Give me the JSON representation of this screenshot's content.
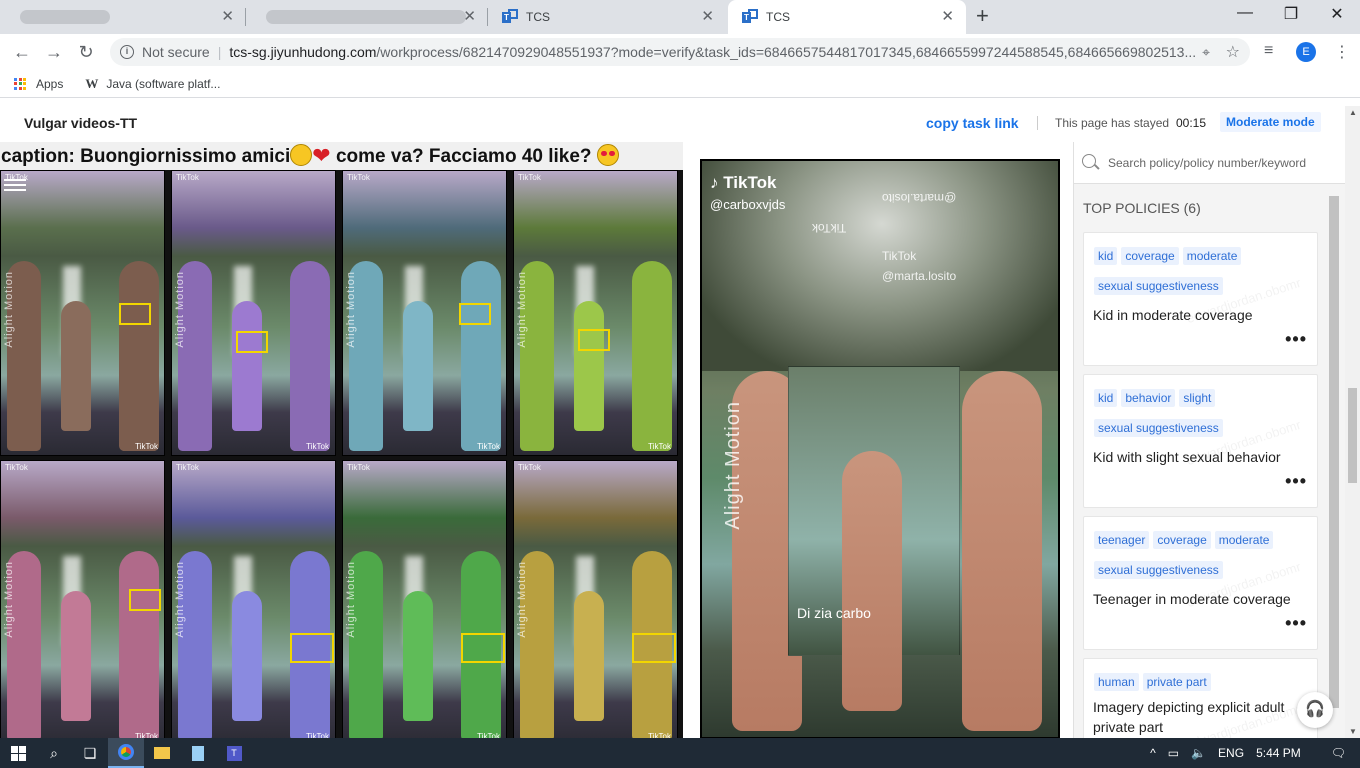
{
  "browser": {
    "tabs": [
      {
        "label": "",
        "blurred": true
      },
      {
        "label": "",
        "blurred": true
      },
      {
        "label": "TCS"
      },
      {
        "label": "TCS",
        "active": true
      }
    ],
    "new_tab": "+",
    "window_controls": {
      "minimize": "—",
      "maximize": "❐",
      "close": "✕"
    },
    "address": {
      "security": "Not secure",
      "host": "tcs-sg.jiyunhudong.com",
      "path": "/workprocess/6821470929048551937?mode=verify&task_ids=6846657544817017345,6846655997244588545,684665669802513..."
    },
    "profile_initial": "E",
    "bookmarks": [
      {
        "label": "Apps",
        "icon": "apps-grid-icon"
      },
      {
        "label": "Java (software platf...",
        "icon": "wikipedia-icon"
      }
    ]
  },
  "header": {
    "title": "Vulgar videos-TT",
    "copy_link": "copy task link",
    "stayed_label": "This page has stayed",
    "stayed_time": "00:15",
    "mode_button": "Moderate mode"
  },
  "caption": {
    "prefix": "caption: Buongiornissimo amici",
    "middle": " come va? Facciamo 40 like? "
  },
  "thumbnails": {
    "watermark": "TikTok",
    "overlay_text": "Alight Motion",
    "count": 8
  },
  "player": {
    "logo": "TikTok",
    "username": "@carboxvjds",
    "side_text": "Alight Motion",
    "caption": "Di zia carbo",
    "mirror_tags": [
      "TikTok",
      "TikTok",
      "@marta.losito",
      "@marta.losito"
    ]
  },
  "sidebar": {
    "search_placeholder": "Search policy/policy number/keyword",
    "section_title": "TOP POLICIES (6)",
    "policies": [
      {
        "tags": [
          "kid",
          "coverage",
          "moderate",
          "sexual suggestiveness"
        ],
        "title": "Kid in moderate coverage"
      },
      {
        "tags": [
          "kid",
          "behavior",
          "slight",
          "sexual suggestiveness"
        ],
        "title": "Kid with slight sexual behavior"
      },
      {
        "tags": [
          "teenager",
          "coverage",
          "moderate",
          "sexual suggestiveness"
        ],
        "title": "Teenager in moderate coverage"
      },
      {
        "tags": [
          "human",
          "private part"
        ],
        "title": "Imagery depicting explicit adult private part"
      }
    ],
    "watermark": "edwardjordan.obomr"
  },
  "taskbar": {
    "language": "ENG",
    "time": "5:44 PM"
  },
  "colors": {
    "accent": "#1a73e8",
    "tag_bg": "#eaf1fd",
    "highlight_box": "#f2d600",
    "taskbar": "#1f2a36"
  }
}
